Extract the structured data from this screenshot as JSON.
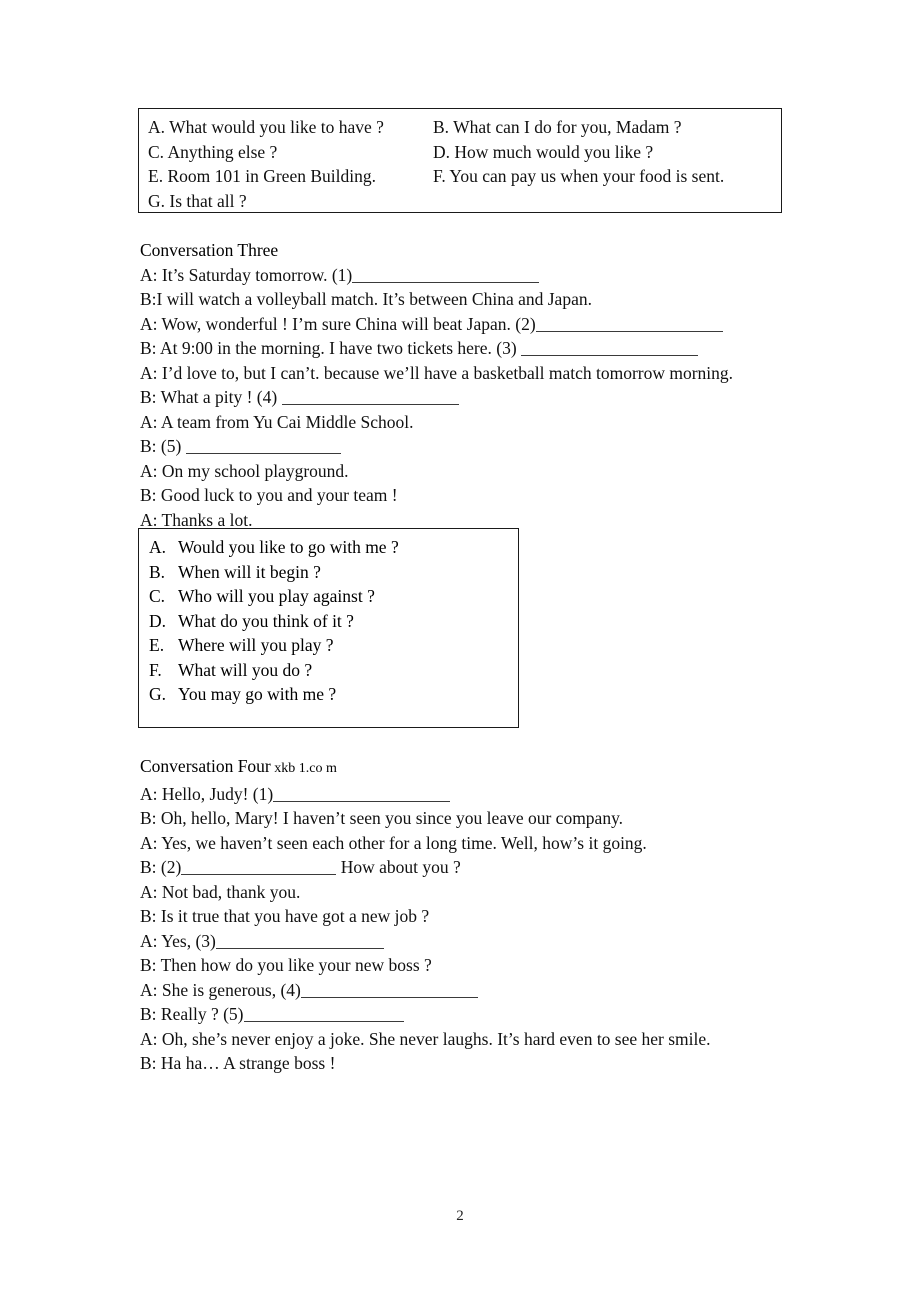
{
  "document": {
    "page_number": "2"
  },
  "option_box_one": {
    "options": [
      "A. What would you like to have ?",
      "B. What can I do for you, Madam ?",
      "C. Anything else ?",
      "D. How much would you like ?",
      "E. Room 101 in Green Building.",
      "F. You can pay us when your food is sent.",
      "G. Is that all ?"
    ]
  },
  "conversation_three": {
    "heading": "Conversation Three",
    "lines": [
      {
        "pre": "A: It’s Saturday tomorrow. (1)",
        "blank": 187,
        "post": ""
      },
      {
        "pre": "B:I will watch a volleyball match. It’s between China and Japan.",
        "blank": 0,
        "post": ""
      },
      {
        "pre": "A: Wow, wonderful ! I’m sure China will beat Japan. (2)",
        "blank": 187,
        "post": ""
      },
      {
        "pre": "B: At 9:00 in the morning. I have two tickets here. (3) ",
        "blank": 177,
        "post": ""
      },
      {
        "pre": "A: I’d love to, but I can’t. because we’ll have a basketball match tomorrow morning.",
        "blank": 0,
        "post": ""
      },
      {
        "pre": "B: What a pity ! (4) ",
        "blank": 177,
        "post": ""
      },
      {
        "pre": "A: A team from Yu Cai Middle School.",
        "blank": 0,
        "post": ""
      },
      {
        "pre": "B: (5) ",
        "blank": 155,
        "post": ""
      },
      {
        "pre": "A: On my school playground.",
        "blank": 0,
        "post": ""
      },
      {
        "pre": "B: Good luck to you and your team !",
        "blank": 0,
        "post": ""
      },
      {
        "pre": "A: Thanks a lot.",
        "blank": 0,
        "post": ""
      }
    ]
  },
  "option_box_two": {
    "options": [
      {
        "letter": "A.",
        "text": "Would you like to go with me ?"
      },
      {
        "letter": "B.",
        "text": "When will it begin ?"
      },
      {
        "letter": "C.",
        "text": "Who will you play against ?"
      },
      {
        "letter": "D.",
        "text": "What do you think of it ?"
      },
      {
        "letter": "E.",
        "text": "Where will you play ?"
      },
      {
        "letter": "F.",
        "text": "What will you do ?"
      },
      {
        "letter": "G.",
        "text": "You may go with me ?"
      }
    ]
  },
  "conversation_four": {
    "heading": "Conversation Four",
    "watermark": " xkb 1.co m",
    "lines": [
      {
        "pre": "A: Hello, Judy! (1)",
        "blank": 177,
        "post": ""
      },
      {
        "pre": "B: Oh, hello, Mary! I haven’t seen you since you leave our company.",
        "blank": 0,
        "post": ""
      },
      {
        "pre": "A: Yes, we haven’t seen each other for a long time. Well, how’s it going.",
        "blank": 0,
        "post": ""
      },
      {
        "pre": "B: (2)",
        "blank": 155,
        "post": " How about you ?"
      },
      {
        "pre": "A: Not bad, thank you.",
        "blank": 0,
        "post": ""
      },
      {
        "pre": "B: Is it true that you have got a new job ?",
        "blank": 0,
        "post": ""
      },
      {
        "pre": "A: Yes, (3)",
        "blank": 168,
        "post": ""
      },
      {
        "pre": "B: Then how do you like your new boss ?",
        "blank": 0,
        "post": ""
      },
      {
        "pre": "A: She is generous, (4)",
        "blank": 177,
        "post": ""
      },
      {
        "pre": "B: Really ? (5)",
        "blank": 160,
        "post": ""
      },
      {
        "pre": "A: Oh, she’s never enjoy a joke. She never laughs. It’s hard even to see her smile.",
        "blank": 0,
        "post": ""
      },
      {
        "pre": "B: Ha ha… A strange boss !",
        "blank": 0,
        "post": ""
      }
    ]
  }
}
